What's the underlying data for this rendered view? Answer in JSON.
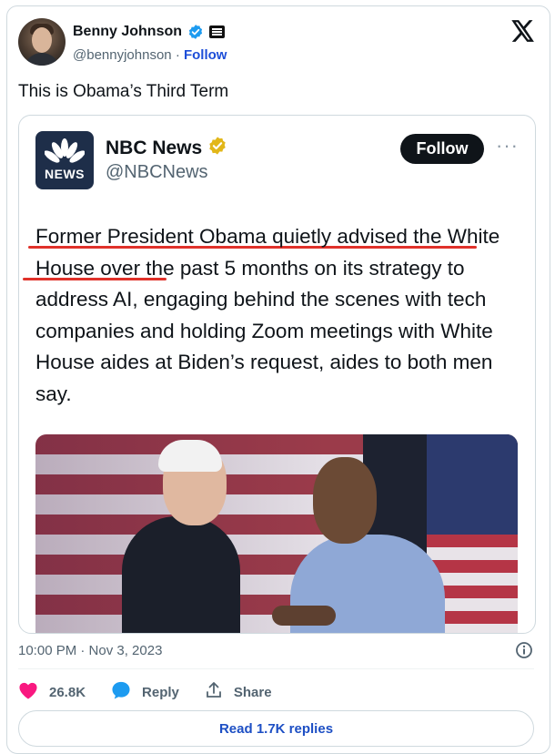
{
  "author": {
    "display_name": "Benny Johnson",
    "handle": "@bennyjohnson",
    "separator": "·",
    "follow_label": "Follow"
  },
  "tweet": {
    "text": "This is Obama’s Third Term"
  },
  "quoted_image": {
    "logo_text": "NEWS",
    "display_name": "NBC News",
    "handle": "@NBCNews",
    "follow_label": "Follow",
    "more_label": "···",
    "body": "Former President Obama quietly advised the White House over the past 5 months on its strategy to address AI, engaging behind the scenes with tech companies and holding Zoom meetings with White House aides at Biden’s request, aides to both men say."
  },
  "meta": {
    "timestamp": "10:00 PM · Nov 3, 2023"
  },
  "actions": {
    "likes": "26.8K",
    "reply_label": "Reply",
    "share_label": "Share"
  },
  "read_replies_label": "Read 1.7K replies",
  "colors": {
    "verified_blue": "#1d9bf0",
    "verified_gold": "#e2b719",
    "heart": "#f91880",
    "underline_red": "#e0312a"
  },
  "icons": [
    "verified-badge-icon",
    "affiliate-badge-icon",
    "x-logo-icon",
    "info-icon",
    "heart-icon",
    "reply-bubble-icon",
    "share-icon"
  ]
}
